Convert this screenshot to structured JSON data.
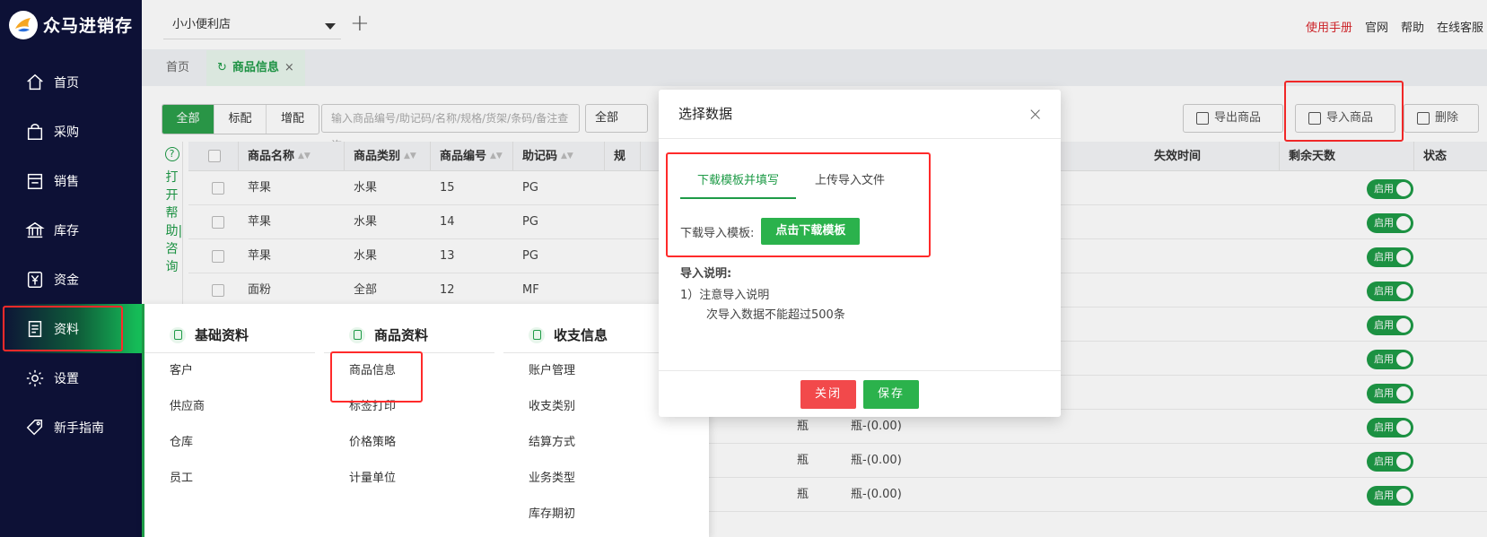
{
  "app": {
    "brand": "众马进销存"
  },
  "sidebar": {
    "items": [
      {
        "label": "首页",
        "icon": "home-icon"
      },
      {
        "label": "采购",
        "icon": "bag-icon"
      },
      {
        "label": "销售",
        "icon": "store-icon"
      },
      {
        "label": "库存",
        "icon": "bank-icon"
      },
      {
        "label": "资金",
        "icon": "yen-icon"
      },
      {
        "label": "资料",
        "icon": "document-icon",
        "active": true
      },
      {
        "label": "设置",
        "icon": "gear-icon"
      },
      {
        "label": "新手指南",
        "icon": "tag-icon"
      }
    ]
  },
  "topbar": {
    "store": "小小便利店",
    "links": [
      "使用手册",
      "官网",
      "帮助",
      "在线客服"
    ]
  },
  "tabs": {
    "home": "首页",
    "current": "商品信息"
  },
  "toolbar": {
    "segments": [
      "全部",
      "标配",
      "增配"
    ],
    "search_placeholder": "输入商品编号/助记码/名称/规格/货架/条码/备注查询",
    "filter": "全部",
    "export": "导出商品",
    "import": "导入商品",
    "delete": "删除"
  },
  "help": {
    "text": "打开帮助|咨询"
  },
  "table": {
    "headers": [
      "商品名称",
      "商品类别",
      "商品编号",
      "助记码",
      "规",
      "失效时间",
      "剩余天数",
      "状态"
    ],
    "rows": [
      {
        "name": "苹果",
        "category": "水果",
        "code": "15",
        "mnemonic": "PG",
        "unit": "",
        "spec": "",
        "status": "启用"
      },
      {
        "name": "苹果",
        "category": "水果",
        "code": "14",
        "mnemonic": "PG",
        "unit": "",
        "spec": "",
        "status": "启用"
      },
      {
        "name": "苹果",
        "category": "水果",
        "code": "13",
        "mnemonic": "PG",
        "unit": "",
        "spec": "",
        "status": "启用"
      },
      {
        "name": "面粉",
        "category": "全部",
        "code": "12",
        "mnemonic": "MF",
        "unit": "",
        "spec": "",
        "status": "启用"
      },
      {
        "name": "",
        "category": "",
        "code": "",
        "mnemonic": "",
        "unit": "",
        "spec": "",
        "status": "启用"
      },
      {
        "name": "",
        "category": "",
        "code": "",
        "mnemonic": "",
        "unit": "",
        "spec": "",
        "status": "启用"
      },
      {
        "name": "",
        "category": "",
        "code": "",
        "mnemonic": "",
        "unit": "",
        "spec": "",
        "status": "启用"
      },
      {
        "name": "",
        "category": "",
        "code": "",
        "mnemonic": "",
        "unit": "瓶",
        "spec": "瓶-(0.00)",
        "status": "启用"
      },
      {
        "name": "",
        "category": "",
        "code": "",
        "mnemonic": "",
        "unit": "瓶",
        "spec": "瓶-(0.00)",
        "status": "启用"
      },
      {
        "name": "",
        "category": "",
        "code": "",
        "mnemonic": "",
        "unit": "瓶",
        "spec": "瓶-(0.00)",
        "status": "启用"
      }
    ]
  },
  "dropdown": {
    "columns": [
      {
        "title": "基础资料",
        "items": [
          "客户",
          "供应商",
          "仓库",
          "员工"
        ]
      },
      {
        "title": "商品资料",
        "items": [
          "商品信息",
          "标签打印",
          "价格策略",
          "计量单位"
        ]
      },
      {
        "title": "收支信息",
        "items": [
          "账户管理",
          "收支类别",
          "结算方式",
          "业务类型",
          "库存期初"
        ]
      }
    ]
  },
  "modal": {
    "title": "选择数据",
    "tab_download": "下载模板并填写",
    "tab_upload": "上传导入文件",
    "download_label": "下载导入模板:",
    "download_button": "点击下载模板",
    "notes_title": "导入说明:",
    "note1": "1）注意导入说明",
    "note2": "次导入数据不能超过500条",
    "close": "关闭",
    "save": "保存"
  }
}
